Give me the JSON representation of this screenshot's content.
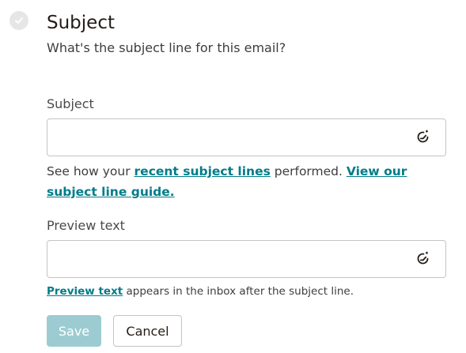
{
  "header": {
    "title": "Subject",
    "subtitle": "What's the subject line for this email?",
    "status_icon": "check-circle-icon"
  },
  "subject_field": {
    "label": "Subject",
    "value": "",
    "placeholder": "",
    "assist_icon": "ai-refresh-icon"
  },
  "subject_help": {
    "prefix": "See how your ",
    "link_recent": "recent subject lines",
    "middle": " performed. ",
    "link_guide": "View our subject line guide."
  },
  "preview_field": {
    "label": "Preview text",
    "value": "",
    "placeholder": "",
    "assist_icon": "ai-refresh-icon"
  },
  "preview_help": {
    "link": "Preview text",
    "suffix": " appears in the inbox after the subject line."
  },
  "actions": {
    "save_label": "Save",
    "cancel_label": "Cancel"
  },
  "colors": {
    "link": "#007c89",
    "save_disabled_bg": "#9cccd1",
    "border": "#c4c4c4"
  }
}
